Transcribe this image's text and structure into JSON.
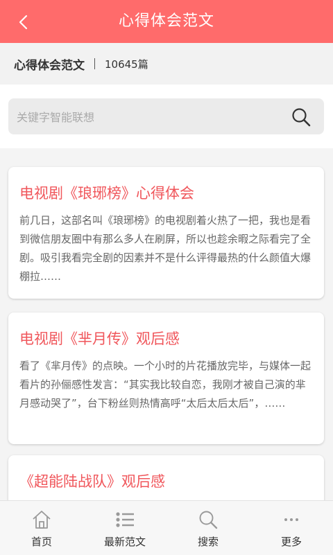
{
  "header": {
    "title": "心得体会范文"
  },
  "info": {
    "category": "心得体会范文",
    "separator": "|",
    "count": "10645篇"
  },
  "search": {
    "placeholder": "关键字智能联想"
  },
  "articles": [
    {
      "title": "电视剧《琅琊榜》心得体会",
      "summary": "前几日，这部名叫《琅琊榜》的电视剧着火热了一把，我也是看到微信朋友圈中有那么多人在刷屏，所以也趁余暇之际看完了全剧。吸引我看完全剧的因素并不是什么评得最热的什么颜值大爆棚拉……"
    },
    {
      "title": "电视剧《芈月传》观后感",
      "summary": "看了《芈月传》的点映。一个小时的片花播放完毕，与媒体一起看片的孙俪感性发言：“其实我比较自恋，我刚才被自己演的芈月感动哭了”，台下粉丝则热情高呼“太后太后太后”，……"
    },
    {
      "title": "《超能陆战队》观后感",
      "summary": ""
    }
  ],
  "nav": [
    {
      "label": "首页",
      "icon": "home-icon"
    },
    {
      "label": "最新范文",
      "icon": "list-icon"
    },
    {
      "label": "搜索",
      "icon": "search-icon"
    },
    {
      "label": "更多",
      "icon": "more-icon"
    }
  ],
  "colors": {
    "accent": "#ff6b6b",
    "title_red": "#f0565b",
    "icon_gray": "#999999"
  }
}
